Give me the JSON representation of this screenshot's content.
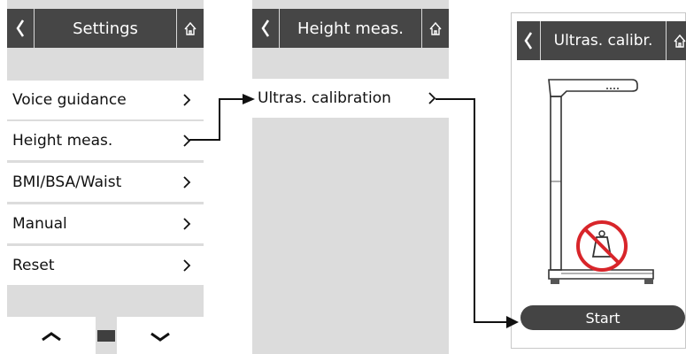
{
  "screens": {
    "settings": {
      "title": "Settings",
      "items": [
        {
          "label": "Voice guidance"
        },
        {
          "label": "Height meas."
        },
        {
          "label": "BMI/BSA/Waist"
        },
        {
          "label": "Manual"
        },
        {
          "label": "Reset"
        }
      ],
      "pager": {
        "up_icon": "chevron-up-icon",
        "down_icon": "chevron-down-icon",
        "indicator": "page-indicator"
      }
    },
    "height_meas": {
      "title": "Height meas.",
      "items": [
        {
          "label": "Ultras. calibration"
        }
      ]
    },
    "ultras_calibr": {
      "title": "Ultras. calibr.",
      "illustration": "height-measuring-station-illustration",
      "warning_icon": "no-weight-icon",
      "start_label": "Start"
    }
  },
  "icons": {
    "back": "chevron-left-icon",
    "home": "home-icon",
    "item": "chevron-right-icon"
  },
  "colors": {
    "header_bg": "#464646",
    "panel_bg": "#dcdcdc",
    "item_bg": "#ffffff",
    "prohibition_red": "#d8252a",
    "start_button_bg": "#444444"
  }
}
